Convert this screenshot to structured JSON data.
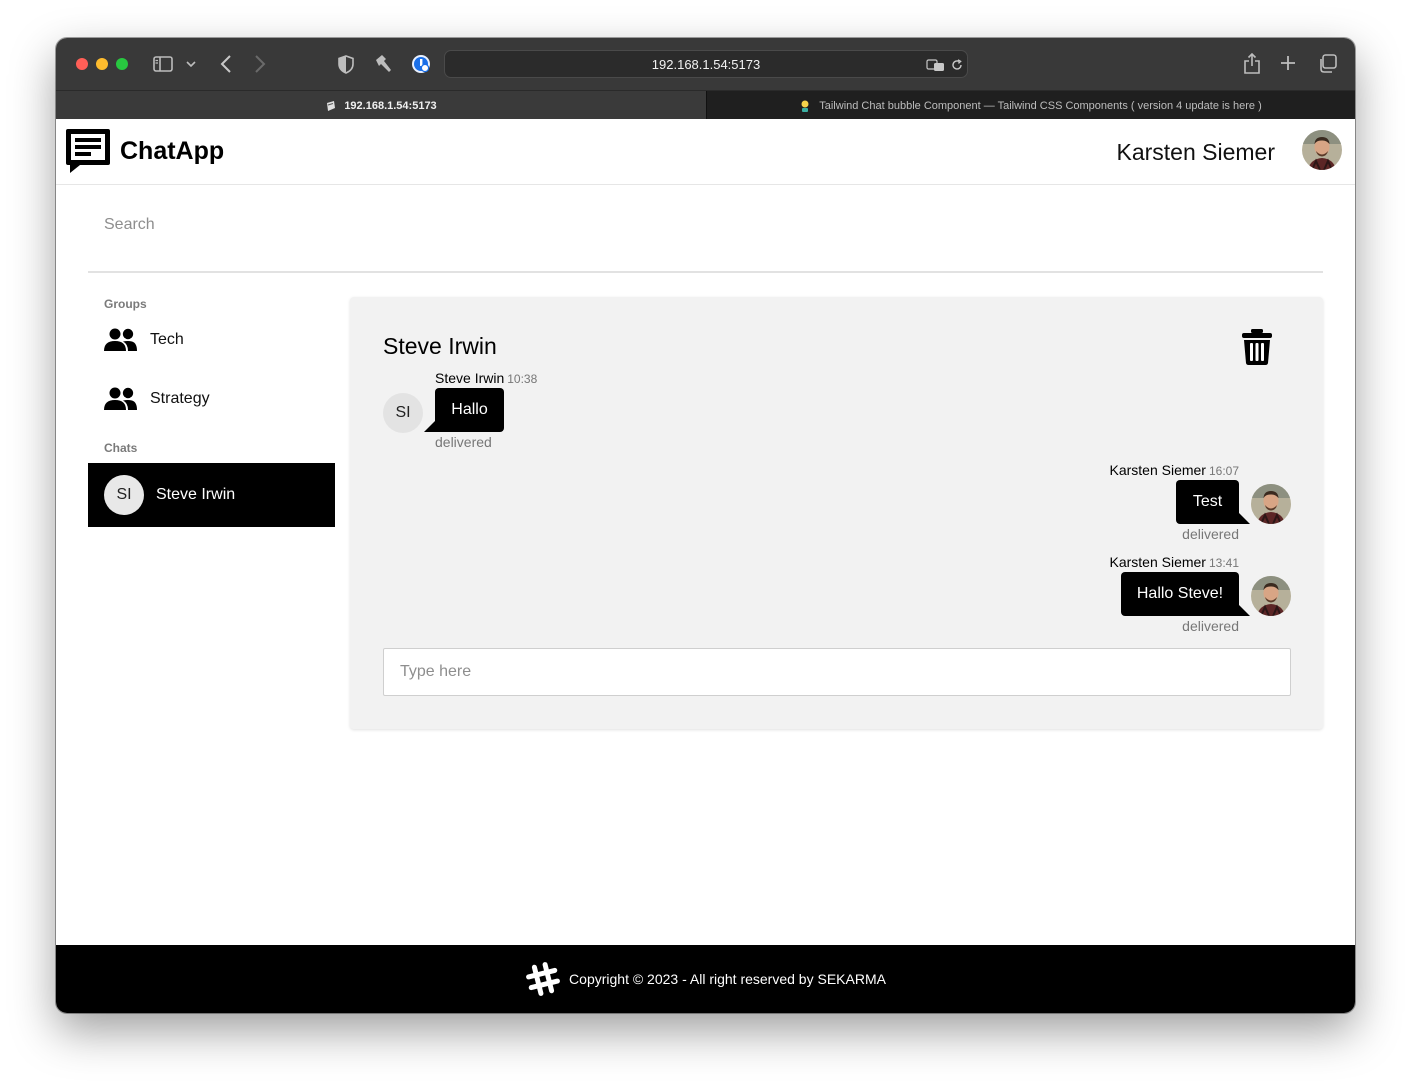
{
  "browser": {
    "url": "192.168.1.54:5173",
    "tabs": [
      {
        "label": "192.168.1.54:5173",
        "active": true
      },
      {
        "label": "Tailwind Chat bubble Component — Tailwind CSS Components ( version 4 update is here )",
        "active": false
      }
    ]
  },
  "app": {
    "name": "ChatApp",
    "current_user": "Karsten Siemer"
  },
  "search": {
    "placeholder": "Search"
  },
  "sidebar": {
    "groups_label": "Groups",
    "groups": [
      {
        "label": "Tech",
        "icon": "users-icon"
      },
      {
        "label": "Strategy",
        "icon": "users-icon"
      }
    ],
    "chats_label": "Chats",
    "chats": [
      {
        "initials": "SI",
        "label": "Steve Irwin",
        "active": true
      }
    ]
  },
  "conversation": {
    "title": "Steve Irwin",
    "messages": [
      {
        "sender": "Steve Irwin",
        "time": "10:38",
        "text": "Hallo",
        "status": "delivered",
        "direction": "incoming",
        "avatar_initials": "SI"
      },
      {
        "sender": "Karsten Siemer",
        "time": "16:07",
        "text": "Test",
        "status": "delivered",
        "direction": "outgoing"
      },
      {
        "sender": "Karsten Siemer",
        "time": "13:41",
        "text": "Hallo Steve!",
        "status": "delivered",
        "direction": "outgoing"
      }
    ],
    "input_placeholder": "Type here"
  },
  "footer": {
    "text": "Copyright © 2023 - All right reserved by SEKARMA"
  },
  "colors": {
    "primary": "#000000",
    "panel_bg": "#f2f2f2",
    "chrome_bg": "#393939",
    "tab_bar_bg": "#1f1f1f"
  }
}
